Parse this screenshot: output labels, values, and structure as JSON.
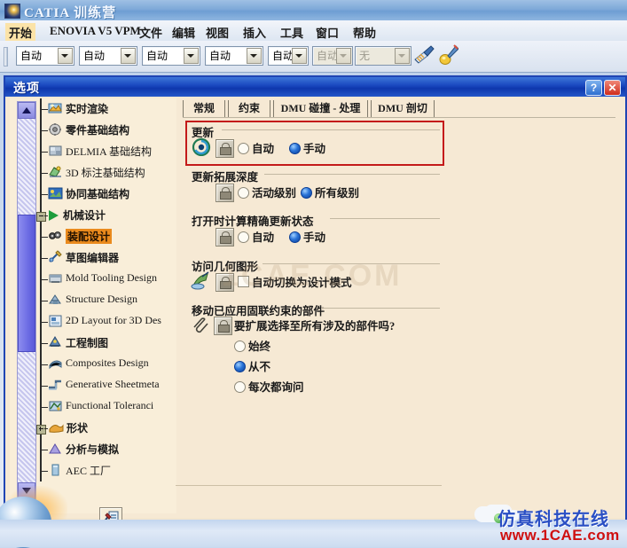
{
  "app": {
    "title": "CATIA 训练营",
    "icon": "catia-logo-icon",
    "menu": [
      {
        "label": "开始",
        "highlighted": true
      },
      {
        "label": "ENOVIA V5 VPM",
        "highlighted": false
      },
      {
        "label": "文件",
        "highlighted": false
      },
      {
        "label": "编辑",
        "highlighted": false
      },
      {
        "label": "视图",
        "highlighted": false
      },
      {
        "label": "插入",
        "highlighted": false
      },
      {
        "label": "工具",
        "highlighted": false
      },
      {
        "label": "窗口",
        "highlighted": false
      },
      {
        "label": "帮助",
        "highlighted": false
      }
    ],
    "toolbar": {
      "combos": [
        {
          "value": "自动",
          "disabled": false
        },
        {
          "value": "自动",
          "disabled": false
        },
        {
          "value": "自动",
          "disabled": false
        },
        {
          "value": "自动",
          "disabled": false
        },
        {
          "value": "自动",
          "disabled": false
        },
        {
          "value": "自动",
          "disabled": true
        },
        {
          "value": "无",
          "disabled": true
        }
      ],
      "brush_icon": "paintbrush-icon",
      "pen_icon": "highlighter-pen-icon"
    }
  },
  "dialog": {
    "title": "选项",
    "help_label": "?",
    "close_label": "✕",
    "tree": {
      "scrollbar": {
        "up_icon": "scroll-up-arrow-icon",
        "down_icon": "scroll-down-arrow-icon"
      },
      "items": [
        {
          "label": "实时渲染",
          "icon": "realtime-render-icon",
          "type": "leaf",
          "selected": false
        },
        {
          "label": "零件基础结构",
          "icon": "part-infrastructure-icon",
          "type": "leaf",
          "selected": false
        },
        {
          "label": "DELMIA 基础结构",
          "icon": "delmia-infrastructure-icon",
          "type": "leaf",
          "selected": false
        },
        {
          "label": "3D 标注基础结构",
          "icon": "3d-annotation-icon",
          "type": "leaf",
          "selected": false
        },
        {
          "label": "协同基础结构",
          "icon": "collaboration-icon",
          "type": "leaf",
          "selected": false
        },
        {
          "label": "机械设计",
          "icon": "mechanical-design-group-icon",
          "type": "group-open",
          "selected": false
        },
        {
          "label": "装配设计",
          "icon": "assembly-design-icon",
          "type": "leaf",
          "selected": true
        },
        {
          "label": "草图编辑器",
          "icon": "sketcher-icon",
          "type": "leaf",
          "selected": false
        },
        {
          "label": "Mold Tooling Design",
          "icon": "mold-tooling-icon",
          "type": "leaf",
          "selected": false
        },
        {
          "label": "Structure Design",
          "icon": "structure-design-icon",
          "type": "leaf",
          "selected": false
        },
        {
          "label": "2D Layout for 3D Des",
          "icon": "2d-layout-icon",
          "type": "leaf",
          "selected": false
        },
        {
          "label": "工程制图",
          "icon": "drafting-icon",
          "type": "leaf",
          "selected": false
        },
        {
          "label": "Composites Design",
          "icon": "composites-design-icon",
          "type": "leaf",
          "selected": false
        },
        {
          "label": "Generative Sheetmeta",
          "icon": "sheetmetal-icon",
          "type": "leaf",
          "selected": false
        },
        {
          "label": "Functional Toleranci",
          "icon": "functional-tolerancing-icon",
          "type": "leaf",
          "selected": false
        },
        {
          "label": "形状",
          "icon": "shape-group-icon",
          "type": "group-closed",
          "selected": false
        },
        {
          "label": "分析与模拟",
          "icon": "analysis-simulation-icon",
          "type": "leaf",
          "selected": false
        },
        {
          "label": "AEC 工厂",
          "icon": "aec-plant-icon",
          "type": "leaf",
          "selected": false
        }
      ],
      "tool_buttons": [
        {
          "icon": "home-settings-icon"
        },
        {
          "icon": "document-settings-icon"
        }
      ]
    },
    "tabs": [
      {
        "label": "常规",
        "active": true
      },
      {
        "label": "约束",
        "active": false
      },
      {
        "label": "DMU 碰撞 - 处理",
        "active": false
      },
      {
        "label": "DMU 剖切",
        "active": false
      }
    ],
    "sections": [
      {
        "id": "update",
        "title": "更新",
        "icon": "update-swirl-icon",
        "lock_icon": "lock-icon",
        "highlighted": true,
        "options": [
          {
            "label": "自动",
            "selected": false,
            "control": "radio"
          },
          {
            "label": "手动",
            "selected": true,
            "control": "radio"
          }
        ]
      },
      {
        "id": "update-extension-depth",
        "title": "更新拓展深度",
        "lock_icon": "lock-icon",
        "highlighted": false,
        "options": [
          {
            "label": "活动级别",
            "selected": false,
            "control": "radio"
          },
          {
            "label": "所有级别",
            "selected": true,
            "control": "radio"
          }
        ]
      },
      {
        "id": "compute-accurate-update-status",
        "title": "打开时计算精确更新状态",
        "lock_icon": "lock-icon",
        "highlighted": false,
        "options": [
          {
            "label": "自动",
            "selected": false,
            "control": "radio"
          },
          {
            "label": "手动",
            "selected": true,
            "control": "radio"
          }
        ]
      },
      {
        "id": "access-geometry",
        "title": "访问几何图形",
        "icon": "geometry-access-icon",
        "lock_icon": "lock-icon",
        "highlighted": false,
        "options": [
          {
            "label": "自动切换为设计模式",
            "selected": false,
            "control": "checkbox"
          }
        ]
      },
      {
        "id": "move-constrained-components",
        "title": "移动已应用固联约束的部件",
        "icon": "paperclip-icon",
        "lock_icon": "lock-icon",
        "highlighted": false,
        "question": "要扩展选择至所有涉及的部件吗?",
        "options": [
          {
            "label": "始终",
            "selected": false,
            "control": "radio"
          },
          {
            "label": "从不",
            "selected": true,
            "control": "radio"
          },
          {
            "label": "每次都询问",
            "selected": false,
            "control": "radio"
          }
        ]
      }
    ]
  },
  "watermark": {
    "page_text": "1CAE.COM",
    "brand_cn": "仿真科技在线",
    "brand_url": "www.1CAE.com",
    "cloud_icon": "cloud-icon",
    "dot_icon": "green-dot-icon"
  },
  "colors": {
    "accent_blue": "#1f45b4",
    "highlight_red": "#c41a1a",
    "selection_orange": "#ea8a1d",
    "dialog_bg": "#f6e9d4",
    "titlebar_blue": "#1a49c0",
    "watermark_red": "#cf1010"
  }
}
